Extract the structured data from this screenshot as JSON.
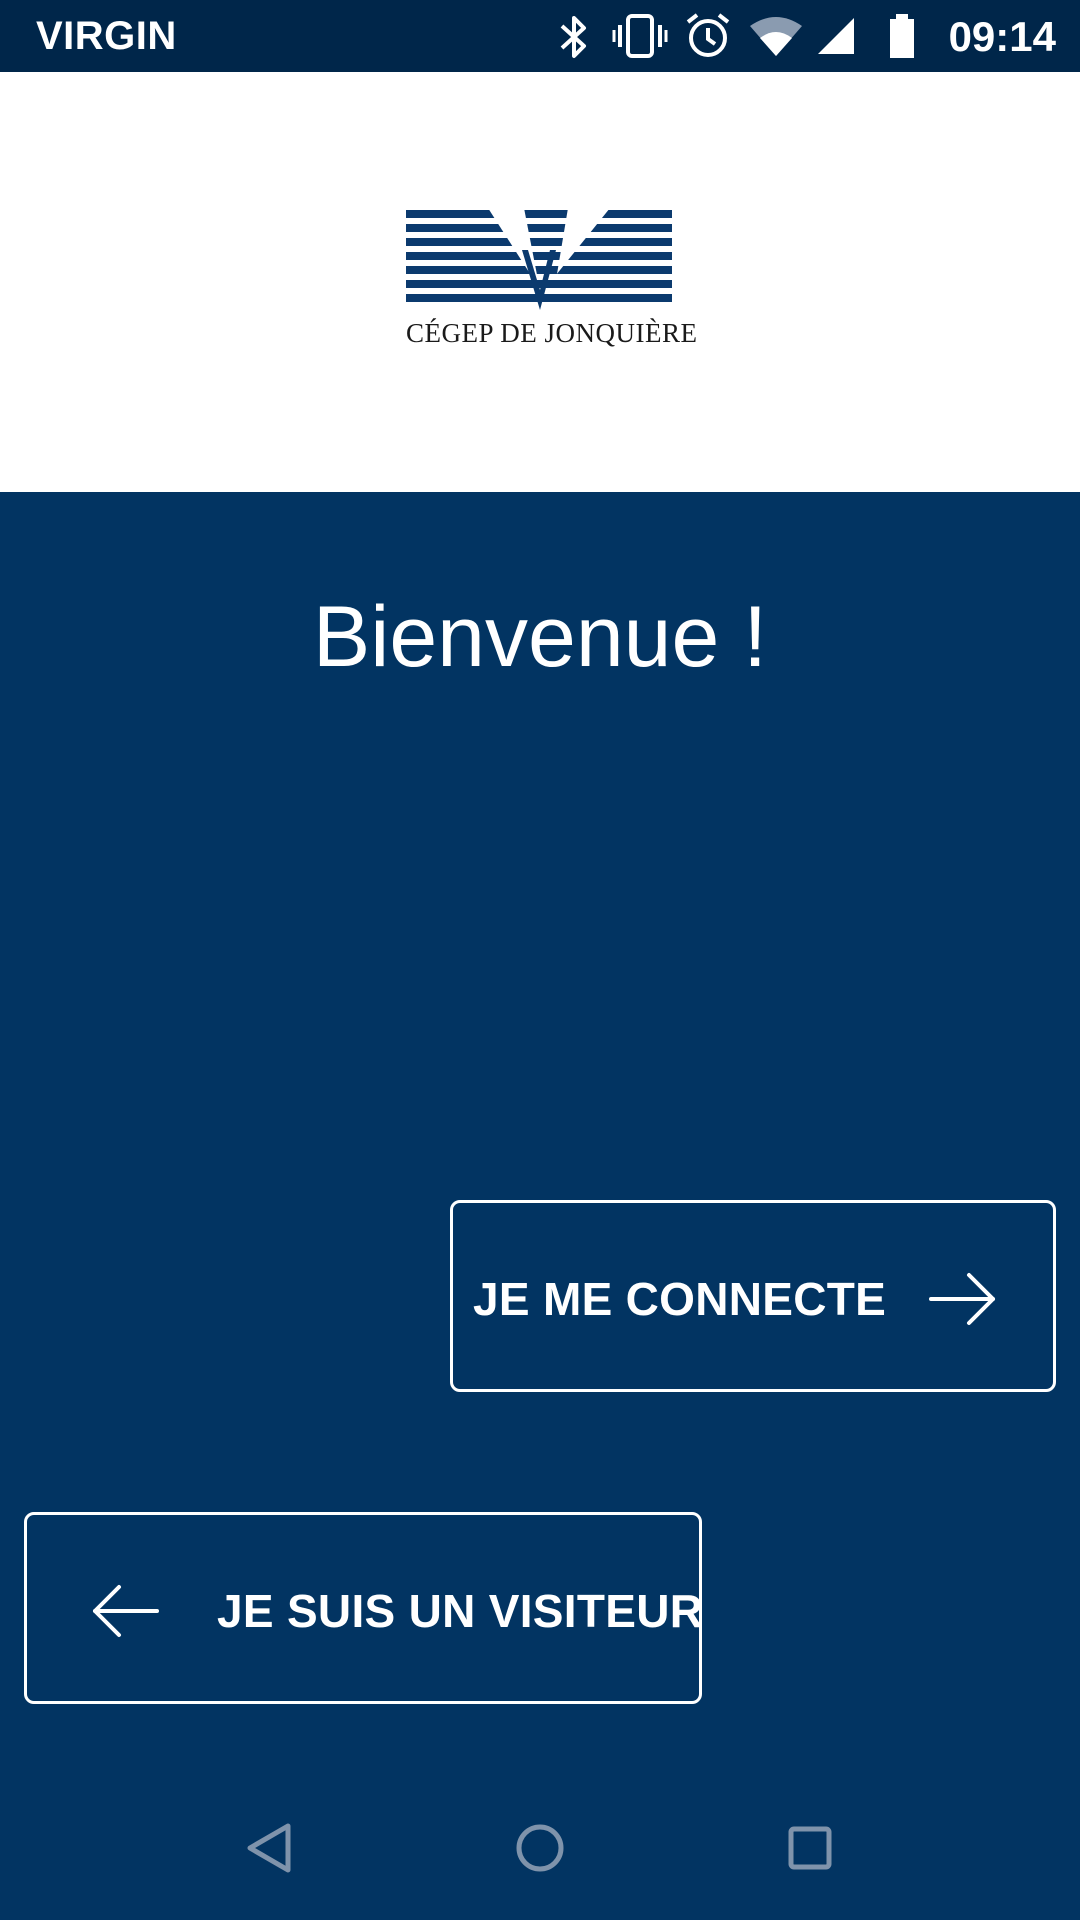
{
  "status_bar": {
    "carrier": "VIRGIN",
    "time": "09:14",
    "icons": [
      "bluetooth-icon",
      "vibrate-icon",
      "alarm-icon",
      "wifi-icon",
      "cell-signal-icon",
      "battery-icon"
    ]
  },
  "header": {
    "logo_text": "CÉGEP DE JONQUIÈRE"
  },
  "main": {
    "welcome": "Bienvenue !",
    "connect_button": {
      "label": "JE ME CONNECTE",
      "icon": "arrow-right-icon"
    },
    "visitor_button": {
      "label": "JE SUIS UN VISITEUR",
      "icon": "arrow-left-icon"
    }
  },
  "nav_bar": {
    "icons": [
      "back-icon",
      "home-icon",
      "recents-icon"
    ]
  },
  "colors": {
    "background": "#023462",
    "status_bar": "#00264a",
    "header": "#ffffff",
    "logo": "#0b3a6e",
    "text": "#ffffff"
  }
}
